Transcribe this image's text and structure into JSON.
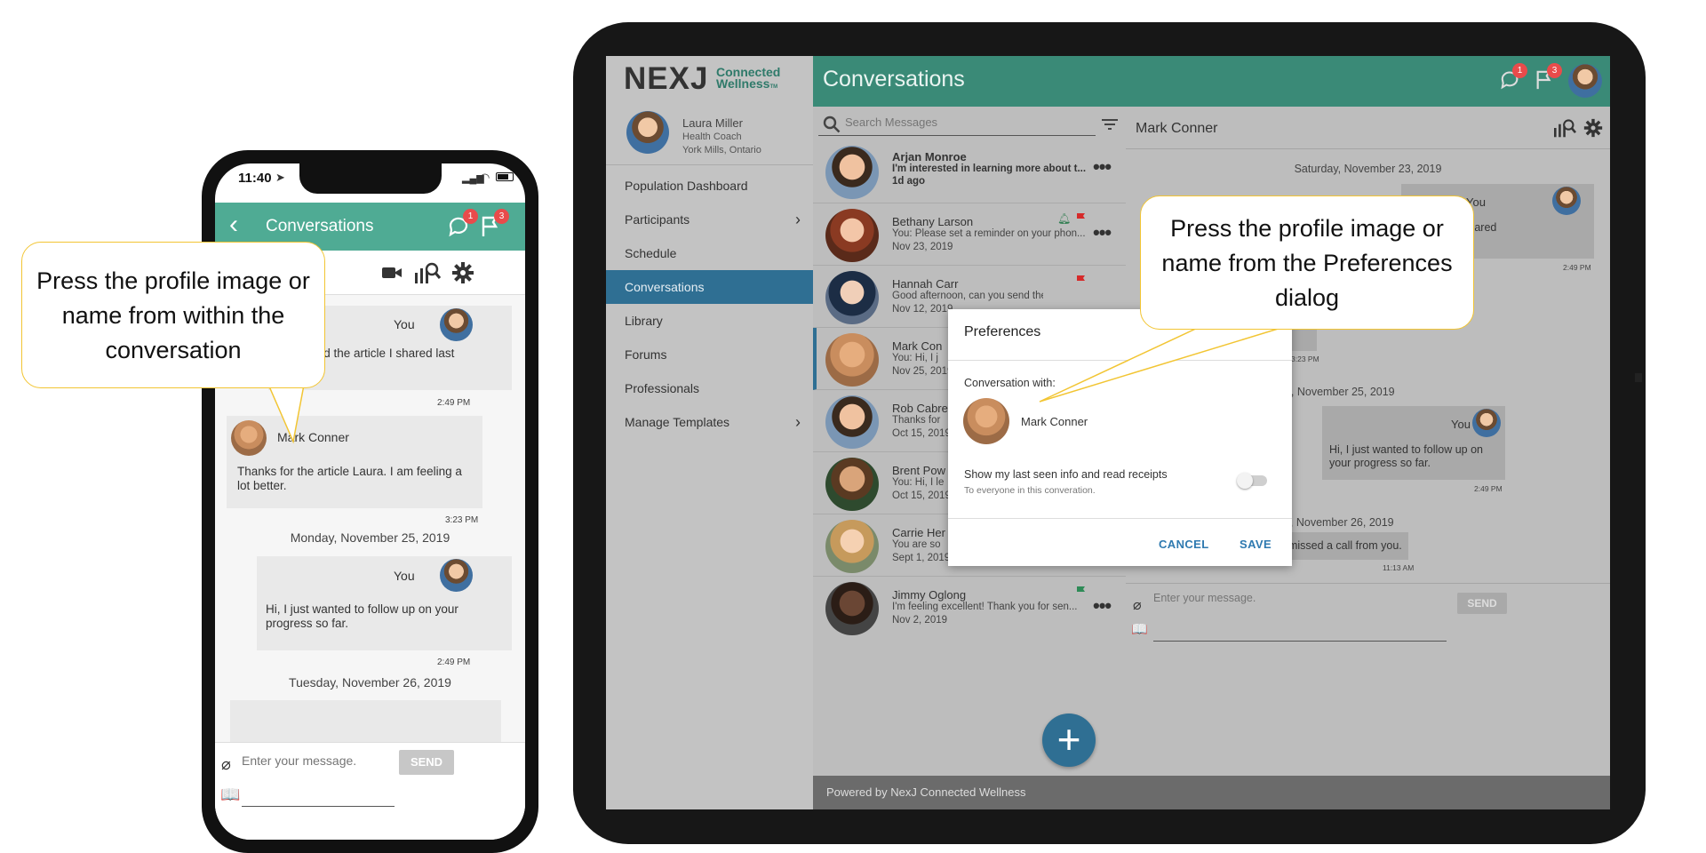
{
  "phone": {
    "time": "11:40",
    "header_title": "Conversations",
    "badge_chat": "1",
    "badge_flag": "3",
    "partial_name": "r",
    "msg1_sender": "You",
    "msg1_text": "er to read the article I shared last week.",
    "msg1_time": "2:49 PM",
    "msg2_sender": "Mark Conner",
    "msg2_text": "Thanks for the article Laura. I am feeling a lot better.",
    "msg2_time": "3:23 PM",
    "date2": "Monday, November 25, 2019",
    "msg3_sender": "You",
    "msg3_text": "Hi, I just wanted to follow up on your progress so far.",
    "msg3_time": "2:49 PM",
    "date3": "Tuesday, November 26, 2019",
    "input_placeholder": "Enter your message.",
    "send_label": "SEND"
  },
  "callouts": {
    "left": "Press the profile image or name from within the conversation",
    "right": "Press the profile image or name from the Preferences dialog"
  },
  "tablet": {
    "logo_main": "NEXJ",
    "logo_sub1": "Connected",
    "logo_sub2": "Wellness",
    "logo_tm": "TM",
    "header_title": "Conversations",
    "badge_chat": "1",
    "badge_flag": "3",
    "user": {
      "name": "Laura Miller",
      "role": "Health Coach",
      "location": "York Mills, Ontario"
    },
    "nav": [
      {
        "label": "Population Dashboard",
        "chevron": false
      },
      {
        "label": "Participants",
        "chevron": true
      },
      {
        "label": "Schedule",
        "chevron": false
      },
      {
        "label": "Conversations",
        "chevron": false,
        "active": true
      },
      {
        "label": "Library",
        "chevron": false
      },
      {
        "label": "Forums",
        "chevron": false
      },
      {
        "label": "Professionals",
        "chevron": false
      },
      {
        "label": "Manage Templates",
        "chevron": true
      }
    ],
    "search_placeholder": "Search Messages",
    "conversations": [
      {
        "name": "Arjan Monroe",
        "preview": "I'm interested in learning more about t...",
        "date": "1d ago"
      },
      {
        "name": "Bethany Larson",
        "preview": "You: Please set a reminder on your phon...",
        "date": "Nov 23, 2019"
      },
      {
        "name": "Hannah Carr",
        "preview": "Good afternoon, can you send the health...",
        "date": "Nov 12, 2019"
      },
      {
        "name": "Mark Con",
        "preview": "You: Hi, I j",
        "date": "Nov 25, 2019"
      },
      {
        "name": "Rob Cabre",
        "preview": "Thanks for",
        "date": "Oct 15, 2019"
      },
      {
        "name": "Brent Pow",
        "preview": "You: Hi, I le",
        "date": "Oct 15, 2019"
      },
      {
        "name": "Carrie Her",
        "preview": "You are so",
        "date": "Sept 1, 2019"
      },
      {
        "name": "Jimmy Oglong",
        "preview": "I'm feeling excellent! Thank you for sen...",
        "date": "Nov 2, 2019"
      }
    ],
    "chat_title": "Mark Conner",
    "date1": "Saturday, November 23, 2019",
    "msg1_sender": "You",
    "msg1_text": "he article I shared",
    "msg1_time": "2:49 PM",
    "msg2_text": ". I am feeling",
    "msg2_time": "3:23 PM",
    "date2": "Monday, November 25, 2019",
    "msg3_sender": "You",
    "msg3_text": "Hi, I just wanted to follow up on your progress so far.",
    "msg3_time": "2:49 PM",
    "date3": "Tuesday, November 26, 2019",
    "missed_call": "Mark Conner missed a call from you.",
    "missed_time": "11:13 AM",
    "input_placeholder": "Enter your message.",
    "send_label": "SEND",
    "powered_by": "Powered by NexJ Connected Wellness",
    "dialog": {
      "title": "Preferences",
      "section_label": "Conversation with:",
      "contact_name": "Mark Conner",
      "toggle_label": "Show my last seen info and read receipts",
      "toggle_sub": "To everyone in this converation.",
      "toggle_on": false,
      "cancel_label": "CANCEL",
      "save_label": "SAVE"
    }
  }
}
